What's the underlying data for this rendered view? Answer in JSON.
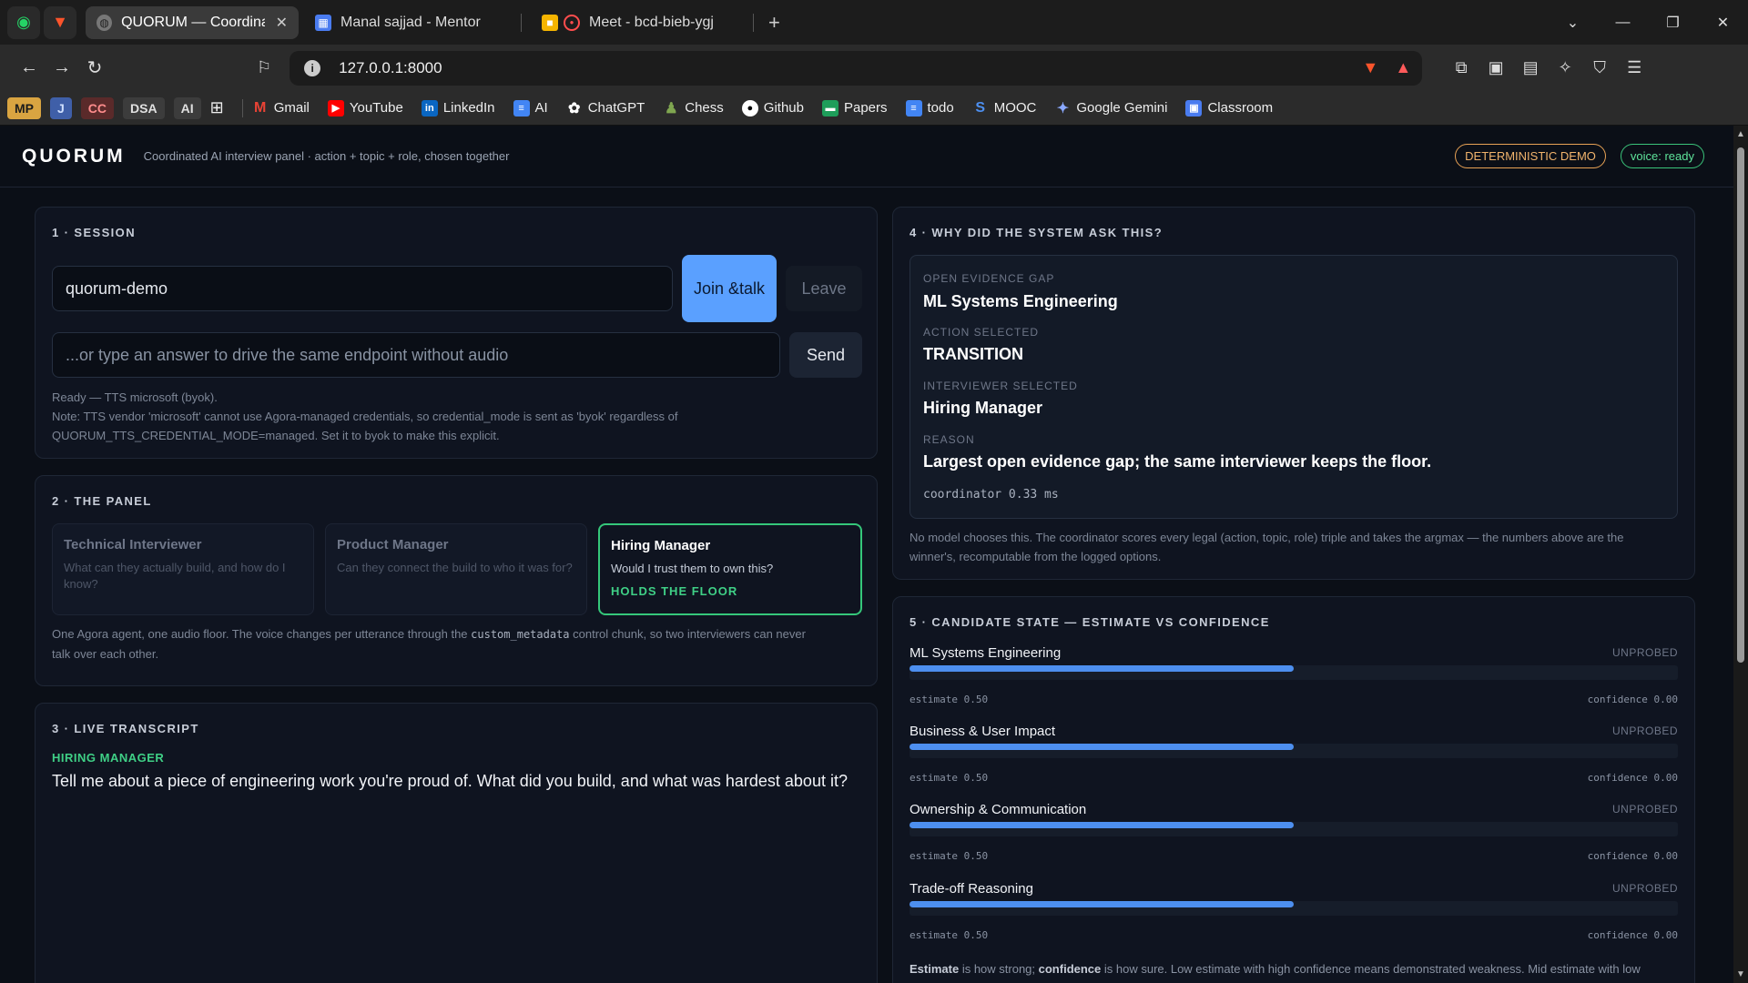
{
  "browser": {
    "tabs": [
      {
        "title": "QUORUM — Coordinated AI Inte",
        "active": true
      },
      {
        "title": "Manal sajjad - Mentor",
        "active": false
      },
      {
        "title": "Meet - bcd-bieb-ygj",
        "active": false
      }
    ],
    "url": "127.0.0.1:8000",
    "bookmark_chips": [
      "MP",
      "J",
      "CC",
      "DSA",
      "AI"
    ],
    "bookmarks": [
      "Gmail",
      "YouTube",
      "LinkedIn",
      "AI",
      "ChatGPT",
      "Chess",
      "Github",
      "Papers",
      "todo",
      "MOOC",
      "Google Gemini",
      "Classroom"
    ]
  },
  "app": {
    "logo": "QUORUM",
    "tagline": "Coordinated AI interview panel · action + topic + role, chosen together",
    "badge_demo": "DETERMINISTIC DEMO",
    "badge_voice": "voice: ready"
  },
  "session": {
    "title": "1 · SESSION",
    "room_value": "quorum-demo",
    "join_label_1": "Join &",
    "join_label_2": "talk",
    "leave_label": "Leave",
    "answer_placeholder": "...or type an answer to drive the same endpoint without audio",
    "send_label": "Send",
    "status_line": "Ready — TTS microsoft (byok).",
    "note_line_1": "Note: TTS vendor 'microsoft' cannot use Agora-managed credentials, so credential_mode is sent as 'byok' regardless of",
    "note_line_2": "QUORUM_TTS_CREDENTIAL_MODE=managed. Set it to byok to make this explicit."
  },
  "panel": {
    "title": "2 · THE PANEL",
    "roles": [
      {
        "name": "Technical Interviewer",
        "question": "What can they actually build, and how do I know?"
      },
      {
        "name": "Product Manager",
        "question": "Can they connect the build to who it was for?"
      },
      {
        "name": "Hiring Manager",
        "question": "Would I trust them to own this?",
        "floor": "HOLDS THE FLOOR"
      }
    ],
    "note_a": "One Agora agent, one audio floor. The voice changes per utterance through the",
    "note_code": "custom_metadata",
    "note_b": "control chunk, so two interviewers can never",
    "note_c": "talk over each other."
  },
  "transcript": {
    "title": "3 · LIVE TRANSCRIPT",
    "speaker": "HIRING MANAGER",
    "text": "Tell me about a piece of engineering work you're proud of. What did you build, and what was hardest about it?"
  },
  "why": {
    "title": "4 · WHY DID THE SYSTEM ASK THIS?",
    "gap_label": "OPEN EVIDENCE GAP",
    "gap_value": "ML Systems Engineering",
    "action_label": "ACTION SELECTED",
    "action_value": "TRANSITION",
    "interviewer_label": "INTERVIEWER SELECTED",
    "interviewer_value": "Hiring Manager",
    "reason_label": "REASON",
    "reason_value": "Largest open evidence gap; the same interviewer keeps the floor.",
    "timing": "coordinator 0.33 ms",
    "foot_1": "No model chooses this. The coordinator scores every legal (action, topic, role) triple and takes the argmax — the numbers above are the",
    "foot_2": "winner's, recomputable from the logged options."
  },
  "candidate": {
    "title": "5 · CANDIDATE STATE — ESTIMATE VS CONFIDENCE",
    "skills": [
      {
        "name": "ML Systems Engineering",
        "tag": "UNPROBED",
        "estimate": 0.5,
        "estimate_label": "estimate 0.50",
        "confidence_label": "confidence 0.00"
      },
      {
        "name": "Business & User Impact",
        "tag": "UNPROBED",
        "estimate": 0.5,
        "estimate_label": "estimate 0.50",
        "confidence_label": "confidence 0.00"
      },
      {
        "name": "Ownership & Communication",
        "tag": "UNPROBED",
        "estimate": 0.5,
        "estimate_label": "estimate 0.50",
        "confidence_label": "confidence 0.00"
      },
      {
        "name": "Trade-off Reasoning",
        "tag": "UNPROBED",
        "estimate": 0.5,
        "estimate_label": "estimate 0.50",
        "confidence_label": "confidence 0.00"
      }
    ],
    "legend_estimate": "Estimate",
    "legend_mid_1": " is how strong; ",
    "legend_confidence": "confidence",
    "legend_rest": " is how sure. Low estimate with high confidence means demonstrated weakness. Mid estimate with low"
  }
}
